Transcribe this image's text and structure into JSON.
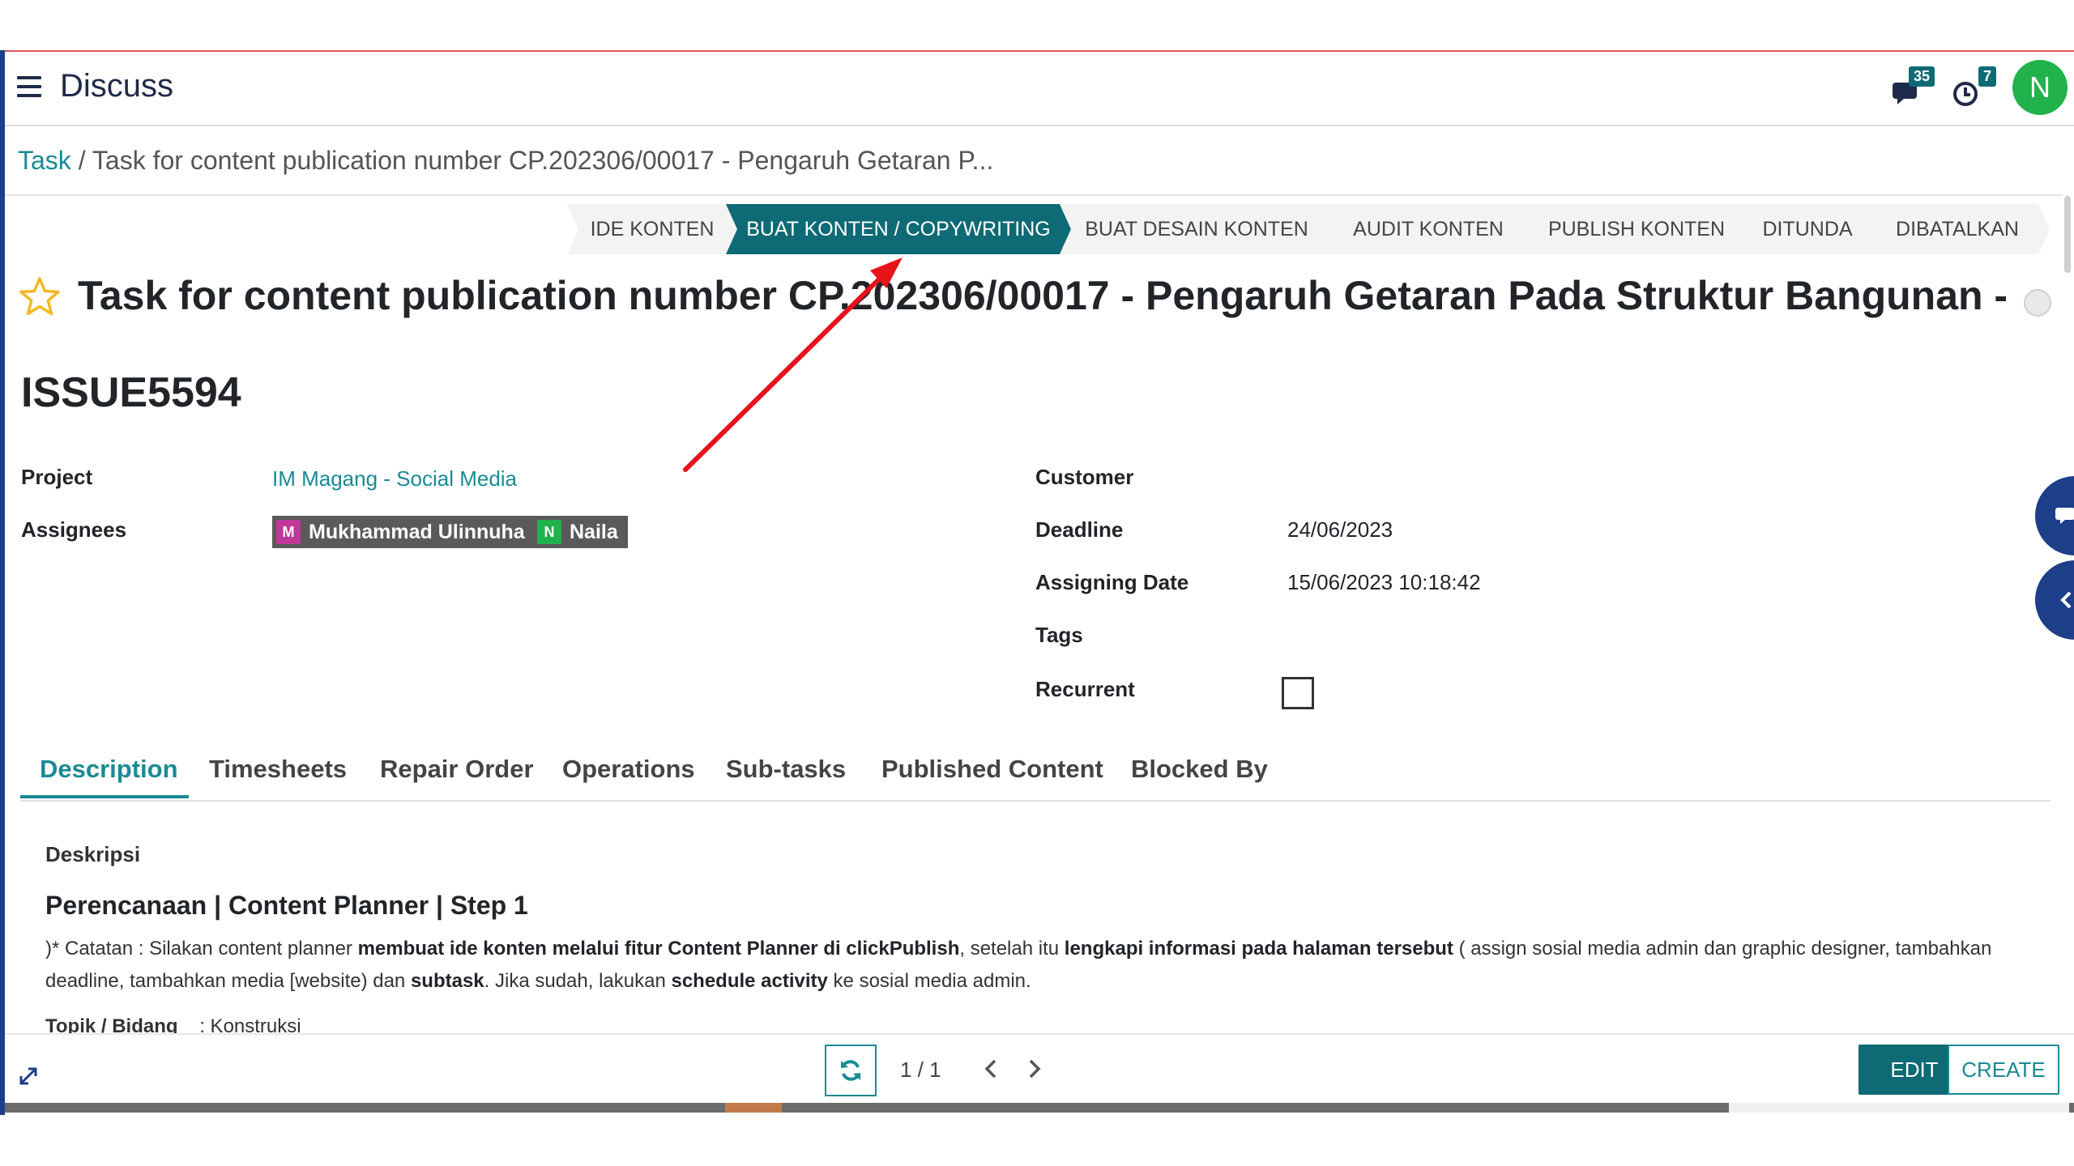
{
  "navbar": {
    "app_title": "Discuss",
    "messages_count": "35",
    "activities_count": "7",
    "avatar_initial": "N"
  },
  "breadcrumb": {
    "parent": "Task",
    "separator": "/",
    "current": "Task for content publication number CP.202306/00017 - Pengaruh Getaran P..."
  },
  "stages": [
    {
      "label": "IDE KONTEN",
      "active": false
    },
    {
      "label": "BUAT KONTEN / COPYWRITING",
      "active": true
    },
    {
      "label": "BUAT DESAIN KONTEN",
      "active": false
    },
    {
      "label": "AUDIT KONTEN",
      "active": false
    },
    {
      "label": "PUBLISH KONTEN",
      "active": false
    },
    {
      "label": "DITUNDA",
      "active": false
    },
    {
      "label": "DIBATALKAN",
      "active": false
    }
  ],
  "record": {
    "title": "Task for content publication number CP.202306/00017 - Pengaruh Getaran Pada Struktur Bangunan - ...",
    "issue_code": "ISSUE5594"
  },
  "fields": {
    "project_label": "Project",
    "project_value": "IM Magang - Social Media",
    "assignees_label": "Assignees",
    "assignees": [
      {
        "initial": "M",
        "name": "Mukhammad Ulinnuha",
        "color": "#c0389a"
      },
      {
        "initial": "N",
        "name": "Naila",
        "color": "#22b24c"
      }
    ],
    "customer_label": "Customer",
    "deadline_label": "Deadline",
    "deadline_value": "24/06/2023",
    "assigning_date_label": "Assigning Date",
    "assigning_date_value": "15/06/2023 10:18:42",
    "tags_label": "Tags",
    "recurrent_label": "Recurrent",
    "recurrent_checked": false
  },
  "tabs": [
    "Description",
    "Timesheets",
    "Repair Order",
    "Operations",
    "Sub-tasks",
    "Published Content",
    "Blocked By"
  ],
  "active_tab": "Description",
  "description": {
    "label": "Deskripsi",
    "heading": "Perencanaan | Content Planner | Step 1",
    "p1_a": ")* Catatan : Silakan content planner ",
    "p1_b": "membuat ide konten melalui fitur Content Planner di clickPublish",
    "p1_c": ", setelah itu ",
    "p1_d": "lengkapi informasi pada halaman tersebut",
    "p1_e": " ( assign sosial media admin dan graphic designer, tambahkan deadline, tambahkan media [website) dan ",
    "p1_f": "subtask",
    "p1_g": ". Jika sudah, lakukan ",
    "p1_h": "schedule activity",
    "p1_i": " ke sosial media admin.",
    "topic_label": "Topik / Bidang",
    "topic_value": ": Konstruksi"
  },
  "pager": {
    "value": "1 / 1"
  },
  "buttons": {
    "edit": "EDIT",
    "create": "CREATE"
  },
  "colors": {
    "accent": "#0e6a74",
    "link": "#1a8a95",
    "annotation_arrow": "#e8121b"
  }
}
